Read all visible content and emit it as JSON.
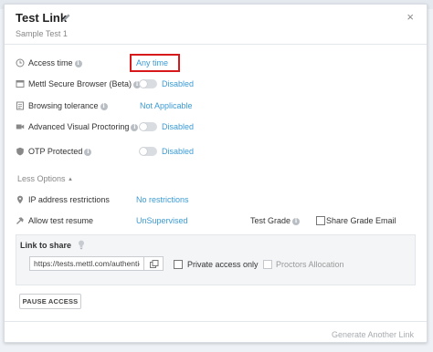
{
  "modal": {
    "title": "Test Link",
    "subtitle": "Sample Test 1",
    "close_label": "×"
  },
  "settings": {
    "access_time": {
      "label": "Access time",
      "value": "Any time"
    },
    "secure_browser": {
      "label": "Mettl Secure Browser (Beta)",
      "status": "Disabled",
      "enabled": false
    },
    "browsing_tolerance": {
      "label": "Browsing tolerance",
      "value": "Not Applicable"
    },
    "visual_proctoring": {
      "label": "Advanced Visual Proctoring",
      "status": "Disabled",
      "enabled": false
    },
    "otp_protected": {
      "label": "OTP Protected",
      "status": "Disabled",
      "enabled": false
    },
    "less_options": "Less Options",
    "ip_restrictions": {
      "label": "IP address restrictions",
      "value": "No restrictions"
    },
    "allow_resume": {
      "label": "Allow test resume",
      "value": "UnSupervised"
    },
    "test_grade": {
      "label": "Test Grade"
    },
    "share_grade_email": {
      "label": "Share Grade Email",
      "checked": false
    }
  },
  "share": {
    "title": "Link to share",
    "url": "https://tests.mettl.com/authenticat",
    "private_access": {
      "label": "Private access only",
      "checked": false
    },
    "proctors_allocation": {
      "label": "Proctors Allocation",
      "checked": false,
      "disabled": true
    }
  },
  "actions": {
    "pause_label": "PAUSE ACCESS",
    "generate_label": "Generate Another Link"
  },
  "colors": {
    "link": "#3a9bd5",
    "highlight": "#d7191c",
    "toggle_off": "#d9dde1"
  }
}
